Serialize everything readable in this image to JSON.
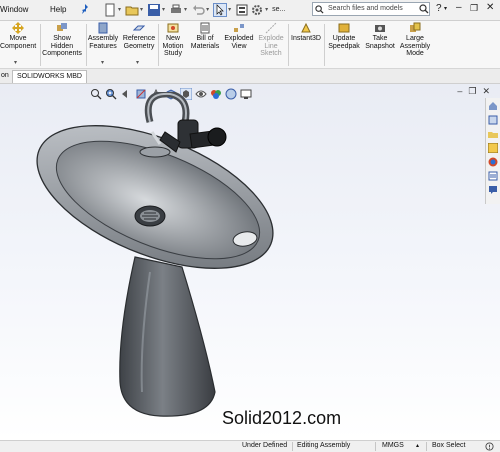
{
  "menu": {
    "window": "Window",
    "help": "Help"
  },
  "quick_access": {
    "selector_label": "se..."
  },
  "search": {
    "placeholder": "Search files and models"
  },
  "ribbon": {
    "move_component": "Move Component",
    "show_hidden": "Show Hidden Components",
    "assembly_features": "Assembly Features",
    "reference_geometry": "Reference Geometry",
    "new_motion_study": "New Motion Study",
    "bill_of_materials": "Bill of Materials",
    "exploded_view": "Exploded View",
    "explode_line_sketch": "Explode Line Sketch",
    "instant3d": "Instant3D",
    "update_speedpak": "Update Speedpak",
    "take_snapshot": "Take Snapshot",
    "large_assembly_mode": "Large Assembly Mode"
  },
  "tabs": {
    "tab1": "on",
    "tab2": "SOLIDWORKS MBD"
  },
  "watermark": "Solid2012.com",
  "status": {
    "under_defined": "Under Defined",
    "editing": "Editing Assembly",
    "units": "MMGS",
    "box_select": "Box Select"
  },
  "colors": {
    "accent": "#1f5fbf",
    "ribbon_bg": "#f7f7f7",
    "viewport_top": "#e9ecf4",
    "sink_body": "#5d6166"
  }
}
